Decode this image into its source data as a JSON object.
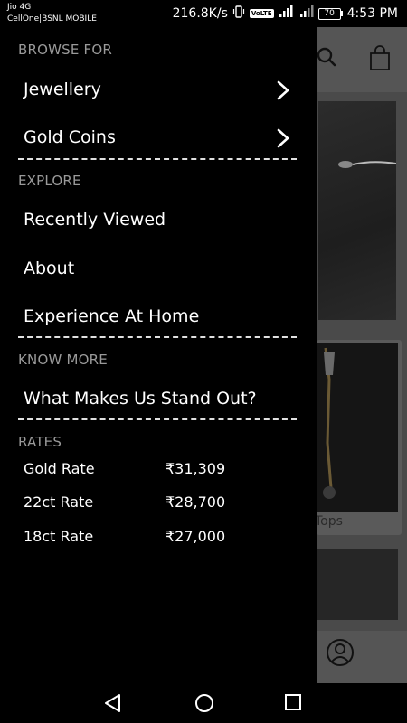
{
  "status_bar": {
    "carrier_primary": "Jio 4G",
    "carrier_secondary": "CellOne|BSNL MOBILE",
    "speed": "216.8K/s",
    "volte": "VoLTE",
    "battery": "70",
    "time": "4:53 PM"
  },
  "drawer": {
    "browse": {
      "header": "BROWSE FOR",
      "items": [
        "Jewellery",
        "Gold Coins"
      ]
    },
    "explore": {
      "header": "EXPLORE",
      "items": [
        "Recently Viewed",
        "About",
        "Experience At Home"
      ]
    },
    "know_more": {
      "header": "KNOW MORE",
      "items": [
        "What Makes Us Stand Out?"
      ]
    },
    "rates": {
      "header": "RATES",
      "items": [
        {
          "label": "Gold Rate",
          "value": "₹31,309"
        },
        {
          "label": "22ct Rate",
          "value": "₹28,700"
        },
        {
          "label": "18ct Rate",
          "value": "₹27,000"
        }
      ]
    }
  },
  "background": {
    "card_label": "Tops"
  },
  "icons": {
    "search": "search-icon",
    "bag": "bag-icon",
    "profile": "profile-icon",
    "chevron": "chevron-right-icon",
    "back": "back-icon",
    "home": "home-icon",
    "recents": "recents-icon"
  }
}
